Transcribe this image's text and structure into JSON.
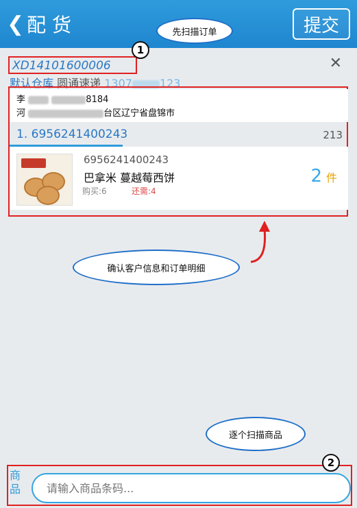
{
  "header": {
    "title": "配 货",
    "submit_label": "提交"
  },
  "callouts": {
    "scan_order": "先扫描订单",
    "confirm_info": "确认客户信息和订单明细",
    "scan_items": "逐个扫描商品"
  },
  "badges": {
    "one": "1",
    "two": "2"
  },
  "order": {
    "number": "XD14101600006",
    "warehouse": "默认仓库",
    "courier": "圆通速递",
    "phone": "1307",
    "phone_tail": "123"
  },
  "customer": {
    "name": "李",
    "name_tail": "8184",
    "addr_prefix": "河",
    "addr_tail": "台区辽宁省盘锦市"
  },
  "item_list": {
    "header_left": "1. 6956241400243",
    "header_right": "213",
    "items": [
      {
        "sku": "6956241400243",
        "name": "巴拿米 蔓越莓西饼",
        "bought_label": "购买:",
        "bought": "6",
        "need_label": "还需:",
        "need": "4",
        "qty": "2",
        "unit": "件"
      }
    ]
  },
  "input": {
    "label": "商品",
    "placeholder": "请输入商品条码..."
  }
}
